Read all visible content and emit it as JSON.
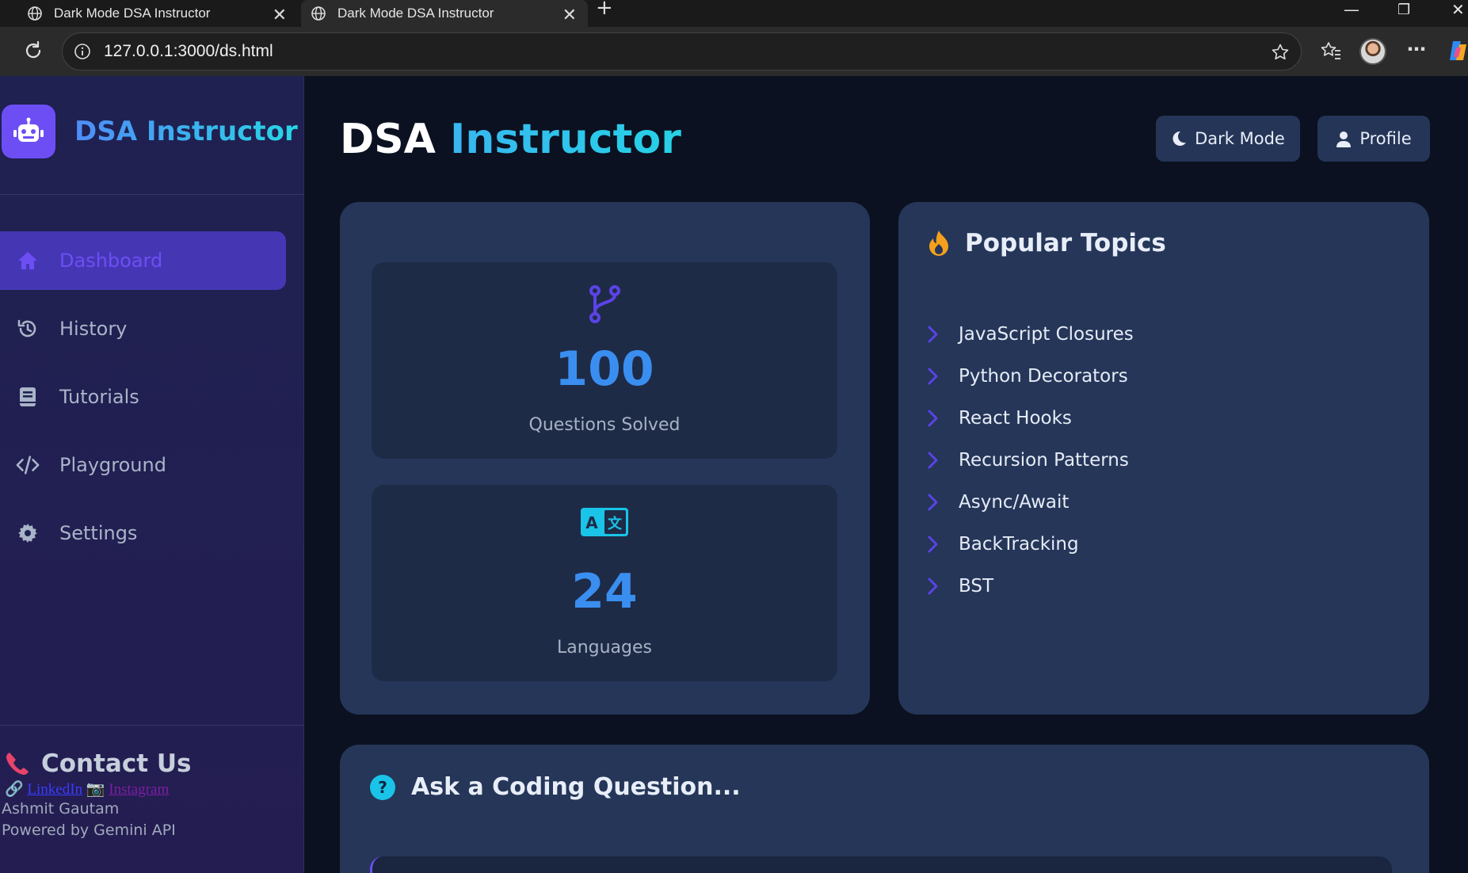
{
  "browser": {
    "tabs": [
      {
        "title": "Dark Mode DSA Instructor"
      },
      {
        "title": "Dark Mode DSA Instructor"
      }
    ],
    "url": "127.0.0.1:3000/ds.html"
  },
  "sidebar": {
    "brand": "DSA Instructor",
    "nav": [
      {
        "label": "Dashboard",
        "icon": "home-icon",
        "active": true
      },
      {
        "label": "History",
        "icon": "history-icon"
      },
      {
        "label": "Tutorials",
        "icon": "book-icon"
      },
      {
        "label": "Playground",
        "icon": "code-icon"
      },
      {
        "label": "Settings",
        "icon": "gear-icon"
      }
    ],
    "contact": {
      "title": "Contact Us",
      "linkedin": "LinkedIn",
      "instagram": "Instagram",
      "name": "Ashmit Gautam",
      "powered": "Powered by Gemini API"
    }
  },
  "header": {
    "title_part1": "DSA ",
    "title_part2": "Instructor",
    "dark_mode_label": "Dark Mode",
    "profile_label": "Profile"
  },
  "stats": [
    {
      "value": "100",
      "label": "Questions Solved",
      "icon": "branch-icon"
    },
    {
      "value": "24",
      "label": "Languages",
      "icon": "translate-icon"
    }
  ],
  "topics": {
    "title": "Popular Topics",
    "items": [
      "JavaScript Closures",
      "Python Decorators",
      "React Hooks",
      "Recursion Patterns",
      "Async/Await",
      "BackTracking",
      "BST"
    ]
  },
  "ask": {
    "title": "Ask a Coding Question..."
  },
  "colors": {
    "accent": "#6d4ef5",
    "stat_number": "#3a8ef0",
    "card_bg": "#253659",
    "main_bg": "#0b1120"
  }
}
